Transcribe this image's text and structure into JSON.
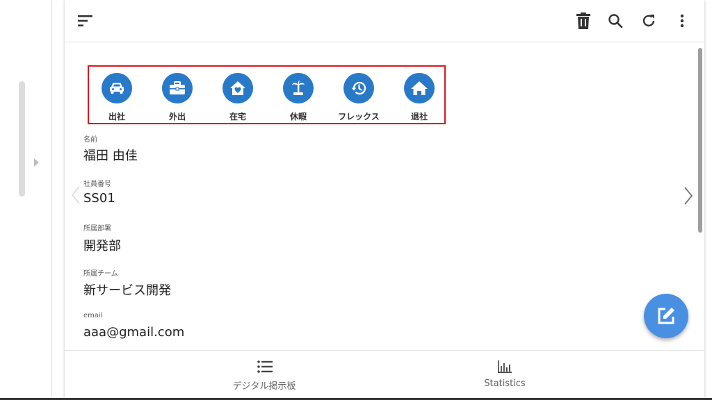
{
  "status_buttons": [
    {
      "label": "出社",
      "icon": "car-icon"
    },
    {
      "label": "外出",
      "icon": "briefcase-icon"
    },
    {
      "label": "在宅",
      "icon": "home-heart-icon"
    },
    {
      "label": "休暇",
      "icon": "beach-icon"
    },
    {
      "label": "フレックス",
      "icon": "history-icon"
    },
    {
      "label": "退社",
      "icon": "home-icon"
    }
  ],
  "fields": [
    {
      "label": "名前",
      "value": "福田 由佳"
    },
    {
      "label": "社員番号",
      "value": "SS01"
    },
    {
      "label": "所属部署",
      "value": "開発部"
    },
    {
      "label": "所属チーム",
      "value": "新サービス開発"
    },
    {
      "label": "email",
      "value": "aaa@gmail.com"
    }
  ],
  "bottom_nav": [
    {
      "label": "デジタル掲示板",
      "icon": "list-icon"
    },
    {
      "label": "Statistics",
      "icon": "bar-chart-icon"
    }
  ],
  "colors": {
    "accent": "#2979c9",
    "fab": "#4a90e2",
    "highlight": "#e0151f"
  }
}
